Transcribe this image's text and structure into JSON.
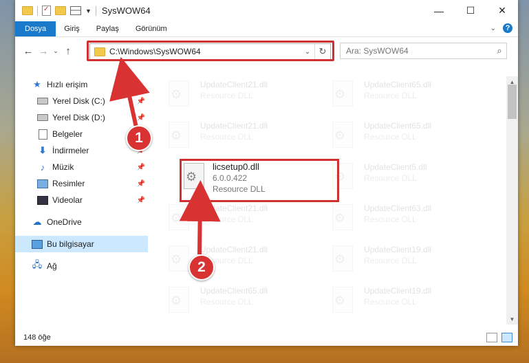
{
  "window": {
    "title": "SysWOW64",
    "controls": [
      "—",
      "☐",
      "✕"
    ]
  },
  "ribbon": {
    "tabs": [
      "Dosya",
      "Giriş",
      "Paylaş",
      "Görünüm"
    ]
  },
  "address": {
    "path": "C:\\Windows\\SysWOW64"
  },
  "search": {
    "placeholder": "Ara: SysWOW64"
  },
  "sidebar": {
    "items": [
      {
        "label": "Hızlı erişim",
        "icon": "star-icon"
      },
      {
        "label": "Yerel Disk (C:)",
        "icon": "disk-icon",
        "pinned": true
      },
      {
        "label": "Yerel Disk (D:)",
        "icon": "disk-icon",
        "pinned": true
      },
      {
        "label": "Belgeler",
        "icon": "documents-icon",
        "pinned": true
      },
      {
        "label": "İndirmeler",
        "icon": "download-icon",
        "pinned": true
      },
      {
        "label": "Müzik",
        "icon": "music-icon",
        "pinned": true
      },
      {
        "label": "Resimler",
        "icon": "pictures-icon",
        "pinned": true
      },
      {
        "label": "Videolar",
        "icon": "videos-icon",
        "pinned": true
      },
      {
        "label": "OneDrive",
        "icon": "cloud-icon"
      },
      {
        "label": "Bu bilgisayar",
        "icon": "computer-icon",
        "selected": true
      },
      {
        "label": "Ağ",
        "icon": "network-icon"
      }
    ]
  },
  "files": {
    "highlighted": {
      "name": "licsetup0.dll",
      "version": "6.0.0.422",
      "type": "Resource DLL"
    },
    "faded": [
      {
        "name": "UpdateClient21.dll",
        "type": "Resource DLL"
      },
      {
        "name": "UpdateClient65.dll",
        "type": "Resource DLL"
      },
      {
        "name": "UpdateClient21.dll",
        "type": "Resource DLL"
      },
      {
        "name": "UpdateClient65.dll",
        "type": "Resource DLL"
      },
      {
        "name": "UpdateClient5.dll",
        "type": "Resource DLL"
      },
      {
        "name": "UpdateClient21.dll",
        "type": "Resource DLL"
      },
      {
        "name": "UpdateClient63.dll",
        "type": "Resource DLL"
      },
      {
        "name": "UpdateClient21.dll",
        "type": "Resource DLL"
      },
      {
        "name": "UpdateClient19.dll",
        "type": "Resource DLL"
      },
      {
        "name": "UpdateClient65.dll",
        "type": "Resource DLL"
      },
      {
        "name": "UpdateClient19.dll",
        "type": "Resource DLL"
      }
    ]
  },
  "status": {
    "count": "148 öğe"
  },
  "annotations": {
    "step1": "1",
    "step2": "2",
    "highlight_color": "#d03030"
  }
}
